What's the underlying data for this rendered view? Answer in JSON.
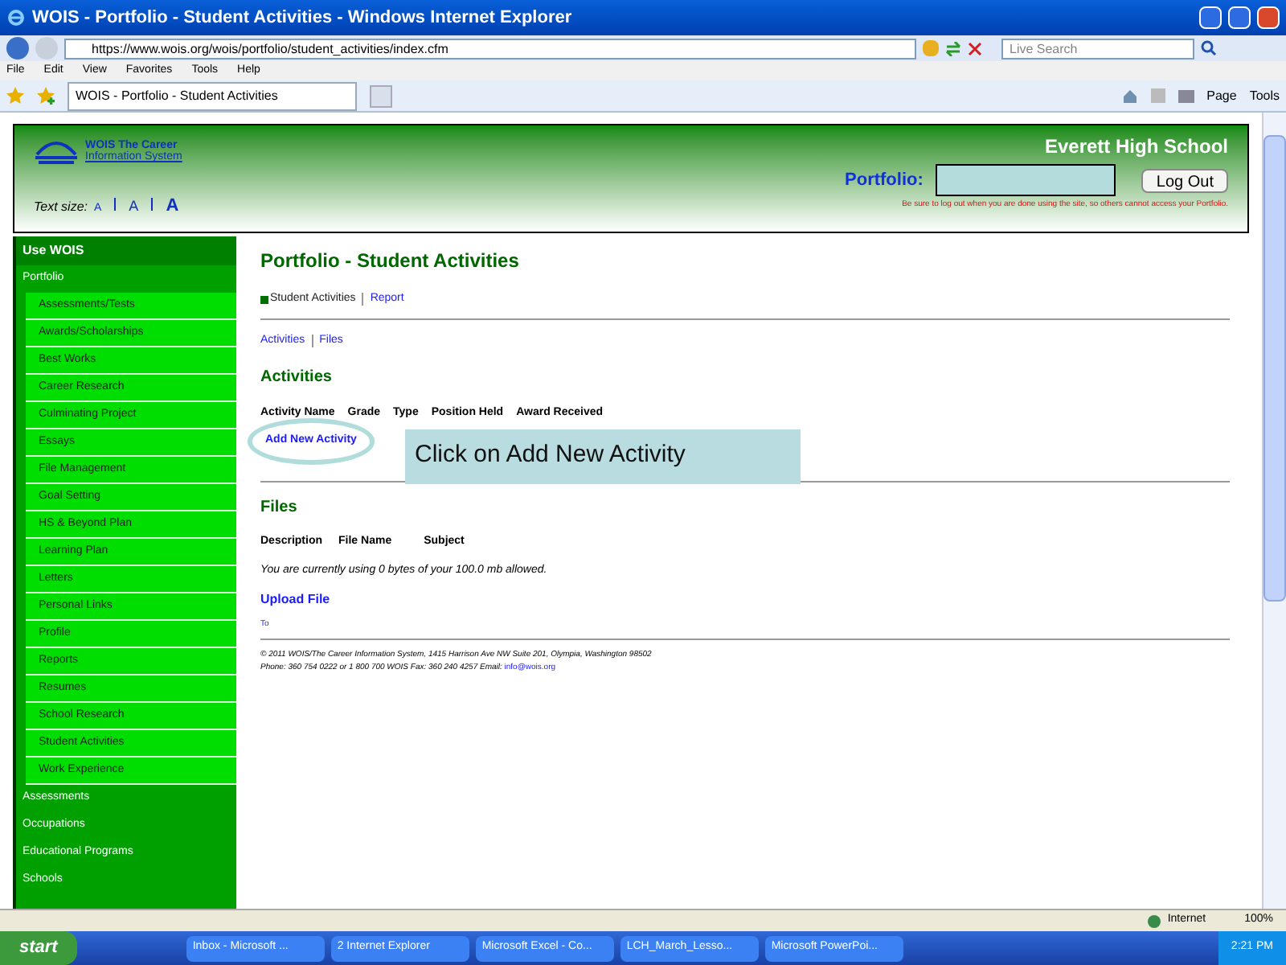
{
  "window": {
    "title": "WOIS - Portfolio - Student Activities - Windows Internet Explorer"
  },
  "address": {
    "value": "https://www.wois.org/wois/portfolio/student_activities/index.cfm"
  },
  "search": {
    "placeholder": "Live Search"
  },
  "menu": [
    "File",
    "Edit",
    "View",
    "Favorites",
    "Tools",
    "Help"
  ],
  "browser_tab": {
    "label": "WOIS - Portfolio - Student Activities"
  },
  "command_bar": [
    "Page",
    "Tools"
  ],
  "header": {
    "logo_top": "WOIS The Career",
    "logo_bottom": "Information System",
    "text_size_label": "Text size:",
    "text_sizes": [
      "A",
      "A",
      "A"
    ],
    "school": "Everett High School",
    "portfolio_label": "Portfolio:",
    "logout": "Log Out",
    "warning": "Be sure to log out when you are done using the site, so others cannot access your Portfolio."
  },
  "sidebar": {
    "title": "Use WOIS",
    "sections": [
      {
        "label": "Portfolio",
        "children": [
          {
            "label": "Assessments/Tests"
          },
          {
            "label": "Awards/Scholarships"
          },
          {
            "label": "Best Works"
          },
          {
            "label": "Career Research"
          },
          {
            "label": "Culminating Project"
          },
          {
            "label": "Essays"
          },
          {
            "label": "File Management"
          },
          {
            "label": "Goal Setting"
          },
          {
            "label": "HS & Beyond Plan"
          },
          {
            "label": "Learning Plan"
          },
          {
            "label": "Letters"
          },
          {
            "label": "Personal Links"
          },
          {
            "label": "Profile"
          },
          {
            "label": "Reports"
          },
          {
            "label": "Resumes"
          },
          {
            "label": "School Research"
          },
          {
            "label": "Student Activities"
          },
          {
            "label": "Work Experience"
          }
        ]
      },
      {
        "label": "Assessments"
      },
      {
        "label": "Occupations"
      },
      {
        "label": "Educational Programs"
      },
      {
        "label": "Schools"
      }
    ]
  },
  "content": {
    "title": "Portfolio - Student Activities",
    "breadcrumb": [
      {
        "label": "Student Activities",
        "selected": true
      },
      {
        "label": "Report",
        "selected": false
      }
    ],
    "subnav": [
      "Activities",
      "Files"
    ],
    "activities": {
      "heading": "Activities",
      "columns": [
        "Activity Name",
        "Grade",
        "Type",
        "Position Held",
        "Award Received"
      ],
      "add_link": "Add New Activity",
      "callout": "Click on Add New Activity"
    },
    "files": {
      "heading": "Files",
      "columns": [
        "Description",
        "File Name",
        "Subject"
      ],
      "usage": "You are currently using 0 bytes of your 100.0 mb allowed.",
      "upload_link": "Upload File",
      "top_link": "To"
    },
    "footer": {
      "line1": "© 2011 WOIS/The Career Information System, 1415 Harrison Ave NW Suite 201, Olympia, Washington 98502",
      "line2": "Phone: 360 754 0222 or 1 800 700 WOIS Fax: 360 240 4257 Email:",
      "email": "info@wois.org"
    }
  },
  "status_bar": {
    "zone": "Internet",
    "zoom": "100%"
  },
  "taskbar": {
    "start": "start",
    "items": [
      "Inbox - Microsoft ...",
      "2 Internet Explorer",
      "Microsoft Excel - Co...",
      "LCH_March_Lesso...",
      "Microsoft PowerPoi..."
    ],
    "clock": "2:21 PM"
  }
}
